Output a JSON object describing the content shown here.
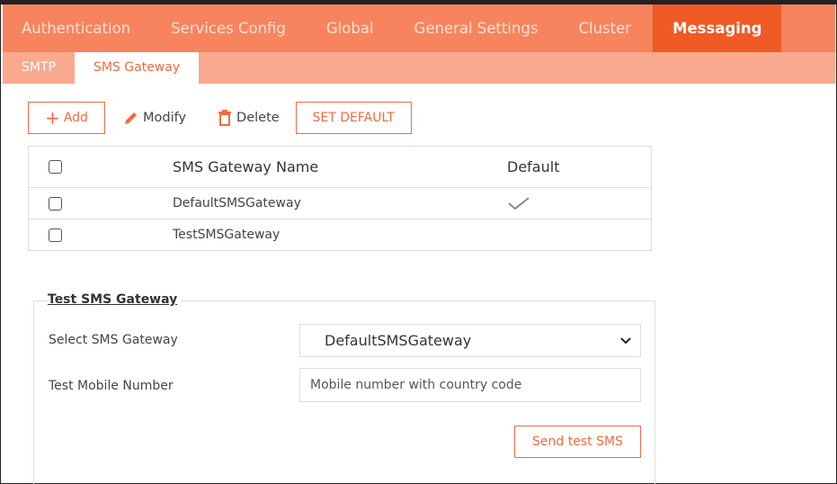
{
  "top_tabs": [
    {
      "label": "Authentication"
    },
    {
      "label": "Services Config"
    },
    {
      "label": "Global"
    },
    {
      "label": "General Settings"
    },
    {
      "label": "Cluster"
    },
    {
      "label": "Messaging"
    }
  ],
  "sub_tabs": [
    {
      "label": "SMTP"
    },
    {
      "label": "SMS Gateway"
    }
  ],
  "toolbar": {
    "add_label": "Add",
    "modify_label": "Modify",
    "delete_label": "Delete",
    "set_default_label": "SET DEFAULT"
  },
  "table": {
    "headers": {
      "name": "SMS Gateway Name",
      "default": "Default"
    },
    "rows": [
      {
        "name": "DefaultSMSGateway",
        "is_default": true
      },
      {
        "name": "TestSMSGateway",
        "is_default": false
      }
    ]
  },
  "test_section": {
    "legend": "Test SMS Gateway",
    "select_label": "Select SMS Gateway",
    "select_value": "DefaultSMSGateway",
    "mobile_label": "Test Mobile Number",
    "mobile_placeholder": "Mobile number with country code",
    "send_label": "Send test SMS"
  },
  "colors": {
    "accent": "#f05a24",
    "nav_bg": "#f7845e",
    "subnav_bg": "#f9a98d"
  }
}
